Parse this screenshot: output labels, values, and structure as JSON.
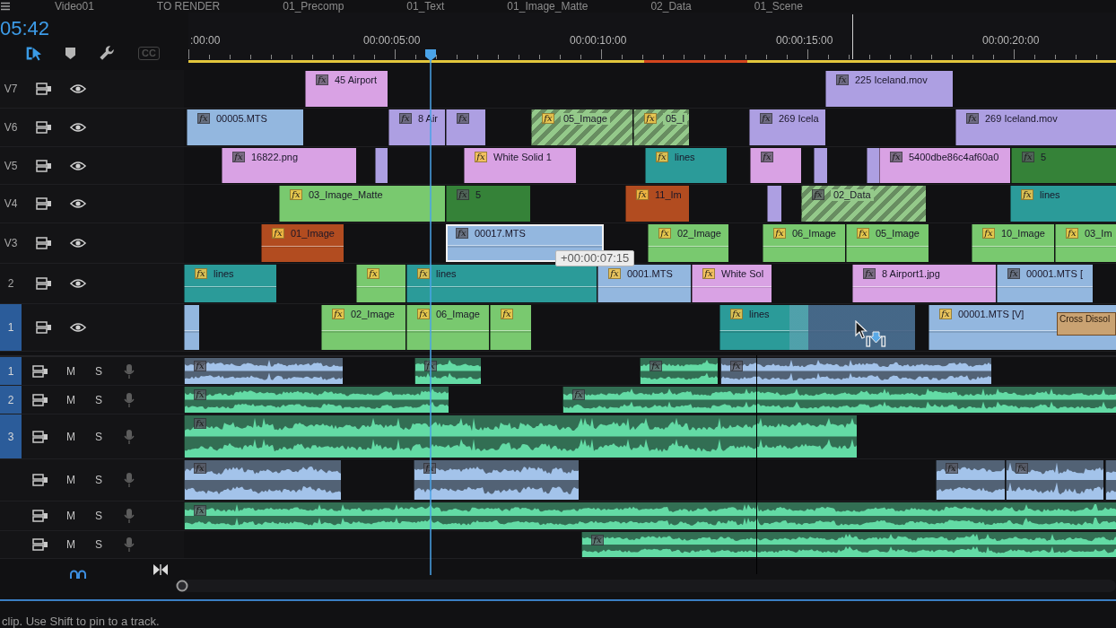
{
  "tabs": [
    {
      "label": "Video01"
    },
    {
      "label": "TO RENDER"
    },
    {
      "label": "01_Precomp"
    },
    {
      "label": "01_Text"
    },
    {
      "label": "01_Image_Matte"
    },
    {
      "label": "02_Data"
    },
    {
      "label": "01_Scene"
    }
  ],
  "timecode": "05:42",
  "toolbar": {
    "snap_on": true,
    "captions": {
      "label": "CC",
      "disabled": true
    }
  },
  "ruler": {
    "labels": [
      ":00:00",
      "00:00:05:00",
      "00:00:10:00",
      "00:00:15:00",
      "00:00:20:00"
    ],
    "render_bar": [
      {
        "color": "#e3c63c"
      },
      {
        "color": "#d4461e"
      },
      {
        "color": "#e3c63c"
      }
    ]
  },
  "video_tracks": [
    {
      "label": "V7",
      "targeted": false,
      "visible": true,
      "expanded": false,
      "clips": [
        {
          "name": "45 Airport",
          "fx": "fx",
          "effects": false,
          "color": "#d9a2e4",
          "hatched": false,
          "selected": false
        },
        {
          "name": "225 Iceland.mov",
          "fx": "fx",
          "effects": false,
          "color": "#ad9fe2",
          "hatched": false,
          "selected": false
        }
      ]
    },
    {
      "label": "V6",
      "targeted": false,
      "visible": true,
      "expanded": false,
      "clips": [
        {
          "name": "00005.MTS",
          "fx": "fx",
          "effects": false,
          "color": "#93b7df",
          "hatched": false,
          "selected": false
        },
        {
          "name": "8 Air",
          "fx": "fx",
          "effects": false,
          "color": "#ad9fe2",
          "hatched": false,
          "selected": false
        },
        {
          "fx": "fx",
          "effects": false,
          "color": "#ad9fe2",
          "hatched": false,
          "selected": false
        },
        {
          "name": "05_Image",
          "fx": "fx",
          "effects": true,
          "color": "#94c98a",
          "hatched": true,
          "selected": false
        },
        {
          "name": "05_I",
          "fx": "fx",
          "effects": true,
          "color": "#94c98a",
          "hatched": true,
          "selected": false
        },
        {
          "name": "269 Icela",
          "fx": "fx",
          "effects": false,
          "color": "#ad9fe2",
          "hatched": false,
          "selected": false
        },
        {
          "name": "269 Iceland.mov",
          "fx": "fx",
          "effects": false,
          "color": "#ad9fe2",
          "hatched": false,
          "selected": false
        }
      ]
    },
    {
      "label": "V5",
      "targeted": false,
      "visible": true,
      "expanded": false,
      "clips": [
        {
          "name": "16822.png",
          "fx": "fx",
          "effects": false,
          "color": "#d9a2e4",
          "hatched": false,
          "selected": false
        },
        {
          "color": "#ad9fe2",
          "hatched": false,
          "selected": false
        },
        {
          "name": "White Solid 1",
          "fx": "fx",
          "effects": true,
          "color": "#d9a2e4",
          "hatched": false,
          "selected": false
        },
        {
          "name": "lines",
          "fx": "fx",
          "effects": true,
          "color": "#2b9b99",
          "hatched": false,
          "selected": false
        },
        {
          "fx": "fx",
          "effects": false,
          "color": "#d9a2e4",
          "hatched": false,
          "selected": false
        },
        {
          "color": "#ad9fe2",
          "hatched": false,
          "selected": false
        },
        {
          "color": "#ad9fe2",
          "hatched": false,
          "selected": false
        },
        {
          "name": "5400dbe86c4af60a0",
          "fx": "fx",
          "effects": false,
          "color": "#d9a2e4",
          "hatched": false,
          "selected": false
        },
        {
          "name": "5",
          "fx": "fx",
          "effects": false,
          "color": "#358238",
          "hatched": false,
          "selected": false
        }
      ]
    },
    {
      "label": "V4",
      "targeted": false,
      "visible": true,
      "expanded": false,
      "clips": [
        {
          "name": "03_Image_Matte",
          "fx": "fx",
          "effects": true,
          "color": "#79c96f",
          "hatched": false,
          "selected": false
        },
        {
          "name": "5",
          "fx": "fx",
          "effects": false,
          "color": "#358238",
          "hatched": false,
          "selected": false
        },
        {
          "name": "11_Im",
          "fx": "fx",
          "effects": true,
          "color": "#b24c20",
          "hatched": false,
          "selected": false
        },
        {
          "color": "#ad9fe2",
          "hatched": false,
          "selected": false
        },
        {
          "name": "02_Data",
          "fx": "fx",
          "effects": false,
          "color": "#94c98a",
          "hatched": true,
          "selected": false
        },
        {
          "name": "lines",
          "fx": "fx",
          "effects": true,
          "color": "#2b9b99",
          "hatched": false,
          "selected": false
        }
      ]
    },
    {
      "label": "V3",
      "targeted": false,
      "visible": true,
      "expanded": true,
      "clips": [
        {
          "name": "01_Image",
          "fx": "fx",
          "effects": true,
          "color": "#b24c20",
          "hatched": false,
          "selected": false
        },
        {
          "name": "00017.MTS",
          "fx": "fx",
          "effects": false,
          "color": "#93b7df",
          "hatched": false,
          "selected": true
        },
        {
          "name": "02_Image",
          "fx": "fx",
          "effects": true,
          "color": "#79c96f",
          "hatched": false,
          "selected": false
        },
        {
          "name": "06_Image",
          "fx": "fx",
          "effects": true,
          "color": "#79c96f",
          "hatched": false,
          "selected": false
        },
        {
          "name": "05_Image",
          "fx": "fx",
          "effects": true,
          "color": "#79c96f",
          "hatched": false,
          "selected": false
        },
        {
          "name": "10_Image",
          "fx": "fx",
          "effects": true,
          "color": "#79c96f",
          "hatched": false,
          "selected": false
        },
        {
          "name": "03_Im",
          "fx": "fx",
          "effects": true,
          "color": "#79c96f",
          "hatched": false,
          "selected": false
        }
      ]
    },
    {
      "label": "2",
      "targeted": false,
      "visible": true,
      "expanded": true,
      "clips": [
        {
          "name": "lines",
          "fx": "fx",
          "effects": true,
          "color": "#2b9b99",
          "hatched": false,
          "selected": false
        },
        {
          "fx": "fx",
          "effects": true,
          "color": "#79c96f",
          "hatched": false,
          "selected": false
        },
        {
          "name": "lines",
          "fx": "fx",
          "effects": true,
          "color": "#2b9b99",
          "hatched": false,
          "selected": false
        },
        {
          "name": "0001.MTS",
          "fx": "fx",
          "effects": true,
          "color": "#93b7df",
          "hatched": false,
          "selected": false
        },
        {
          "name": "White Sol",
          "fx": "fx",
          "effects": true,
          "color": "#d9a2e4",
          "hatched": false,
          "selected": false
        },
        {
          "name": "8 Airport1.jpg",
          "fx": "fx",
          "effects": false,
          "color": "#d9a2e4",
          "hatched": false,
          "selected": false
        },
        {
          "name": "00001.MTS [",
          "fx": "fx",
          "effects": false,
          "color": "#93b7df",
          "hatched": false,
          "selected": false
        }
      ]
    },
    {
      "label": "1",
      "targeted": true,
      "visible": true,
      "expanded": true,
      "drop_preview": true,
      "clips": [
        {
          "color": "#93b7df",
          "hatched": false,
          "selected": false
        },
        {
          "name": "02_Image",
          "fx": "fx",
          "effects": true,
          "color": "#79c96f",
          "hatched": false,
          "selected": false
        },
        {
          "name": "06_Image",
          "fx": "fx",
          "effects": true,
          "color": "#79c96f",
          "hatched": false,
          "selected": false
        },
        {
          "fx": "fx",
          "effects": true,
          "color": "#79c96f",
          "hatched": false,
          "selected": false
        },
        {
          "name": "lines",
          "fx": "fx",
          "effects": true,
          "color": "#2b9b99",
          "hatched": false,
          "selected": false
        },
        {
          "name": "00001.MTS [V]",
          "fx": "fx",
          "effects": true,
          "color": "#93b7df",
          "hatched": false,
          "selected": false,
          "transition": "Cross Dissol"
        }
      ]
    }
  ],
  "audio_tracks": [
    {
      "label": "1",
      "targeted": true,
      "mute": "M",
      "solo": "S",
      "expanded": false,
      "clips": [
        {
          "fx": "fx",
          "color": "#a3c3ea"
        },
        {
          "fx": "fx",
          "color": "#63dba5"
        },
        {
          "fx": "fx",
          "color": "#63dba5"
        },
        {
          "fx": "fx",
          "color": "#a3c3ea"
        }
      ]
    },
    {
      "label": "2",
      "targeted": true,
      "mute": "M",
      "solo": "S",
      "expanded": false,
      "clips": [
        {
          "fx": "fx",
          "color": "#63dba5"
        },
        {
          "fx": "fx",
          "color": "#63dba5"
        }
      ]
    },
    {
      "label": "3",
      "targeted": true,
      "mute": "M",
      "solo": "S",
      "expanded": true,
      "clips": [
        {
          "fx": "fx",
          "color": "#63dba5"
        }
      ]
    },
    {
      "targeted": false,
      "mute": "M",
      "solo": "S",
      "expanded": true,
      "clips": [
        {
          "fx": "fx",
          "color": "#a3c3ea"
        },
        {
          "fx": "fx",
          "color": "#a3c3ea"
        },
        {
          "fx": "fx",
          "color": "#a3c3ea"
        },
        {
          "fx": "fx",
          "color": "#a3c3ea"
        },
        {
          "color": "#a3c3ea"
        }
      ]
    },
    {
      "targeted": false,
      "mute": "M",
      "solo": "S",
      "expanded": false,
      "clips": [
        {
          "fx": "fx",
          "color": "#63dba5"
        }
      ]
    },
    {
      "targeted": false,
      "mute": "M",
      "solo": "S",
      "expanded": false,
      "clips": [
        {
          "fx": "fx",
          "color": "#63dba5"
        }
      ]
    }
  ],
  "drag_tooltip": "+00:00:07:15",
  "status_bar": "clip. Use Shift to pin to a track."
}
